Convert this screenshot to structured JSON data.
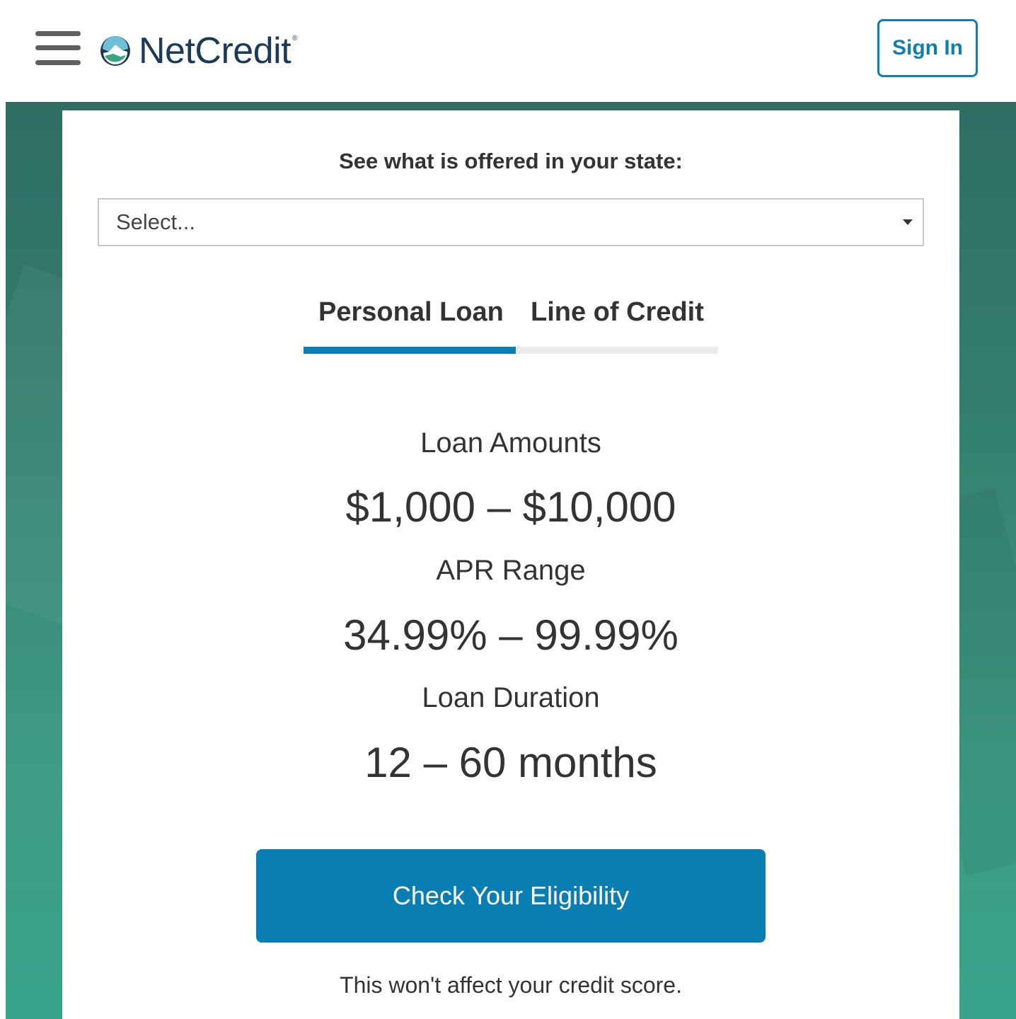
{
  "header": {
    "brand": "NetCredit",
    "brand_mark": "®",
    "sign_in_label": "Sign In"
  },
  "state_selector": {
    "label": "See what is offered in your state:",
    "selected_value": "Select..."
  },
  "tabs": [
    {
      "label": "Personal Loan",
      "active": true
    },
    {
      "label": "Line of Credit",
      "active": false
    }
  ],
  "stats": {
    "loan_amounts": {
      "label": "Loan Amounts",
      "value": "$1,000 – $10,000"
    },
    "apr_range": {
      "label": "APR Range",
      "value": "34.99% – 99.99%"
    },
    "loan_duration": {
      "label": "Loan Duration",
      "value": "12 – 60 months"
    }
  },
  "cta": {
    "label": "Check Your Eligibility",
    "disclaimer": "This won't affect your credit score."
  },
  "colors": {
    "accent": "#0e7fb3",
    "brand_text": "#1b3a57",
    "background_green": "#347f6f"
  }
}
